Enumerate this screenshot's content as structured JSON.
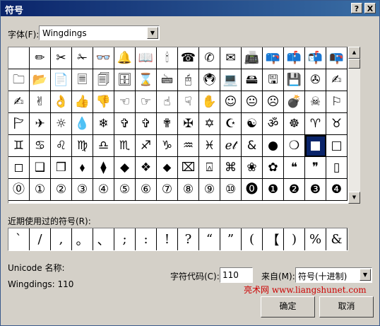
{
  "window": {
    "title": "符号",
    "help_label": "?",
    "close_label": "X"
  },
  "font": {
    "label": "字体(F):",
    "value": "Wingdings"
  },
  "symbol_grid": [
    [
      "",
      "✏",
      "✂",
      "✁",
      "👓",
      "🔔",
      "📖",
      "🕯",
      "☎",
      "✆",
      "✉",
      "📠",
      "📪",
      "📫",
      "📬",
      "📭"
    ],
    [
      "🗀",
      "📂",
      "📄",
      "🗏",
      "🗐",
      "🗄",
      "⌛",
      "🖮",
      "🖰",
      "🖲",
      "💻",
      "🖴",
      "🖫",
      "💾",
      "✇",
      "✍"
    ],
    [
      "✍",
      "✌",
      "👌",
      "👍",
      "👎",
      "☜",
      "☞",
      "☝",
      "☟",
      "✋",
      "☺",
      "😐",
      "☹",
      "💣",
      "☠",
      "⚐"
    ],
    [
      "🏱",
      "✈",
      "☼",
      "💧",
      "❄",
      "✞",
      "✞",
      "✟",
      "✠",
      "✡",
      "☪",
      "☯",
      "ॐ",
      "☸",
      "♈",
      "♉"
    ],
    [
      "♊",
      "♋",
      "♌",
      "♍",
      "♎",
      "♏",
      "♐",
      "♑",
      "♒",
      "♓",
      "ℯ𝓉",
      "&",
      "●",
      "❍",
      "■",
      "□"
    ],
    [
      "◻",
      "❑",
      "❒",
      "⬧",
      "⧫",
      "◆",
      "❖",
      "⬥",
      "⌧",
      "⍓",
      "⌘",
      "❀",
      "✿",
      "❝",
      "❞",
      "▯"
    ],
    [
      "⓪",
      "①",
      "②",
      "③",
      "④",
      "⑤",
      "⑥",
      "⑦",
      "⑧",
      "⑨",
      "⑩",
      "⓿",
      "❶",
      "❷",
      "❸",
      "❹"
    ]
  ],
  "recent": {
    "label": "近期使用过的符号(R):",
    "symbols": [
      "`",
      "/",
      ",",
      "。",
      "、",
      ";",
      ":",
      "!",
      "?",
      "“",
      "”",
      "(",
      "【",
      ")",
      "%",
      "&"
    ]
  },
  "unicode_label": "Unicode 名称:",
  "char_name": "Wingdings: 110",
  "char_code": {
    "label": "字符代码(C):",
    "value": "110"
  },
  "from": {
    "label": "来自(M):",
    "value": "符号(十进制)"
  },
  "watermark": "亮术网 www.liangshunet.com",
  "buttons": {
    "ok": "确定",
    "cancel": "取消"
  }
}
